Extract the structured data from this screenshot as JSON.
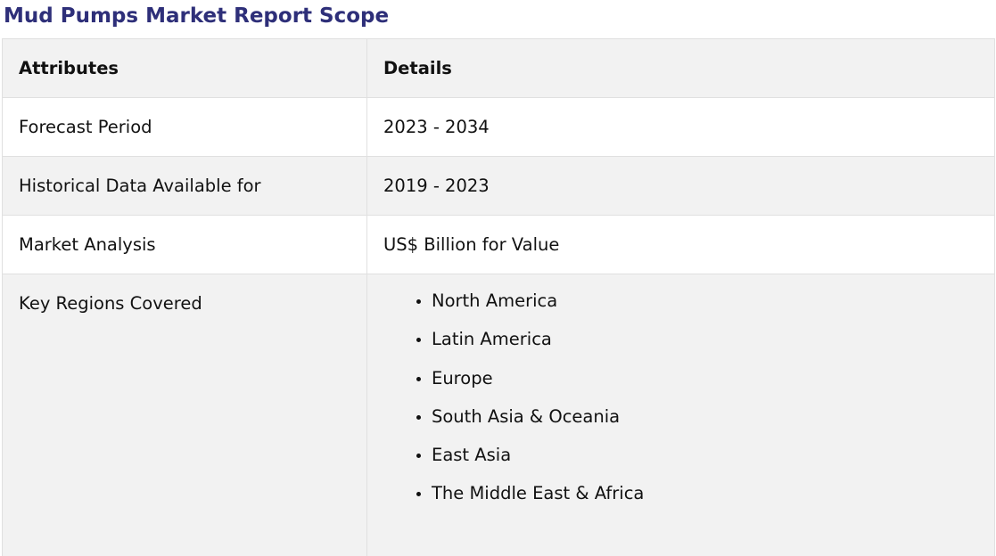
{
  "title": "Mud Pumps Market Report Scope",
  "table": {
    "headers": [
      "Attributes",
      "Details"
    ],
    "rows": [
      {
        "attribute": "Forecast Period",
        "detail": "2023 - 2034"
      },
      {
        "attribute": "Historical Data Available for",
        "detail": "2019 - 2023"
      },
      {
        "attribute": "Market Analysis",
        "detail": "US$ Billion for Value"
      }
    ],
    "regions": {
      "attribute": "Key Regions Covered",
      "items": [
        "North America",
        "Latin America",
        "Europe",
        "South Asia & Oceania",
        "East Asia",
        "The Middle East & Africa"
      ]
    }
  },
  "colors": {
    "title": "#2e2f79",
    "header_bg": "#f2f2f2",
    "alt_row_bg": "#f2f2f2",
    "border": "#e0e0e0"
  }
}
